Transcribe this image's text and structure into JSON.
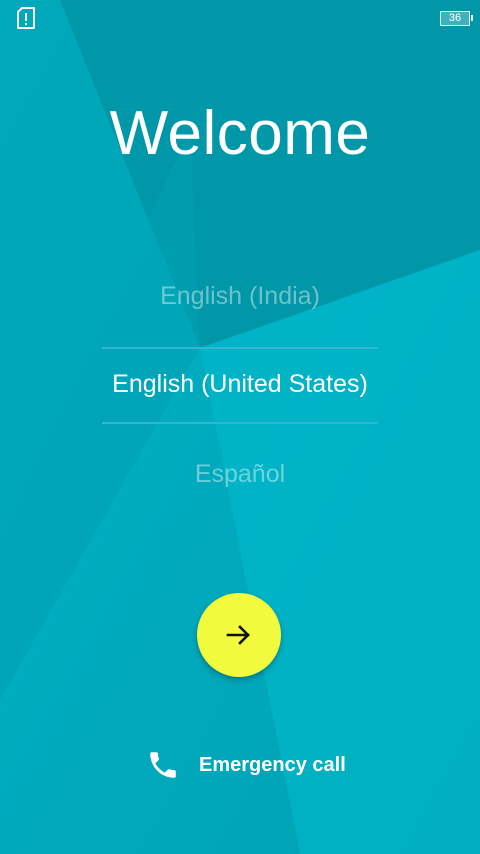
{
  "status_bar": {
    "sim_icon": "sim-card-alert-icon",
    "battery_level": "36"
  },
  "welcome": {
    "title": "Welcome"
  },
  "language_picker": {
    "options": [
      "English (India)",
      "English (United States)",
      "Español"
    ],
    "selected": "English (United States)"
  },
  "next_button": {
    "icon": "arrow-right-icon",
    "color": "#f1fa3d"
  },
  "emergency": {
    "icon": "phone-icon",
    "label": "Emergency call"
  },
  "colors": {
    "background_teal": "#00a3b5",
    "divider": "#33b5d8",
    "accent_yellow": "#f1fa3d"
  }
}
